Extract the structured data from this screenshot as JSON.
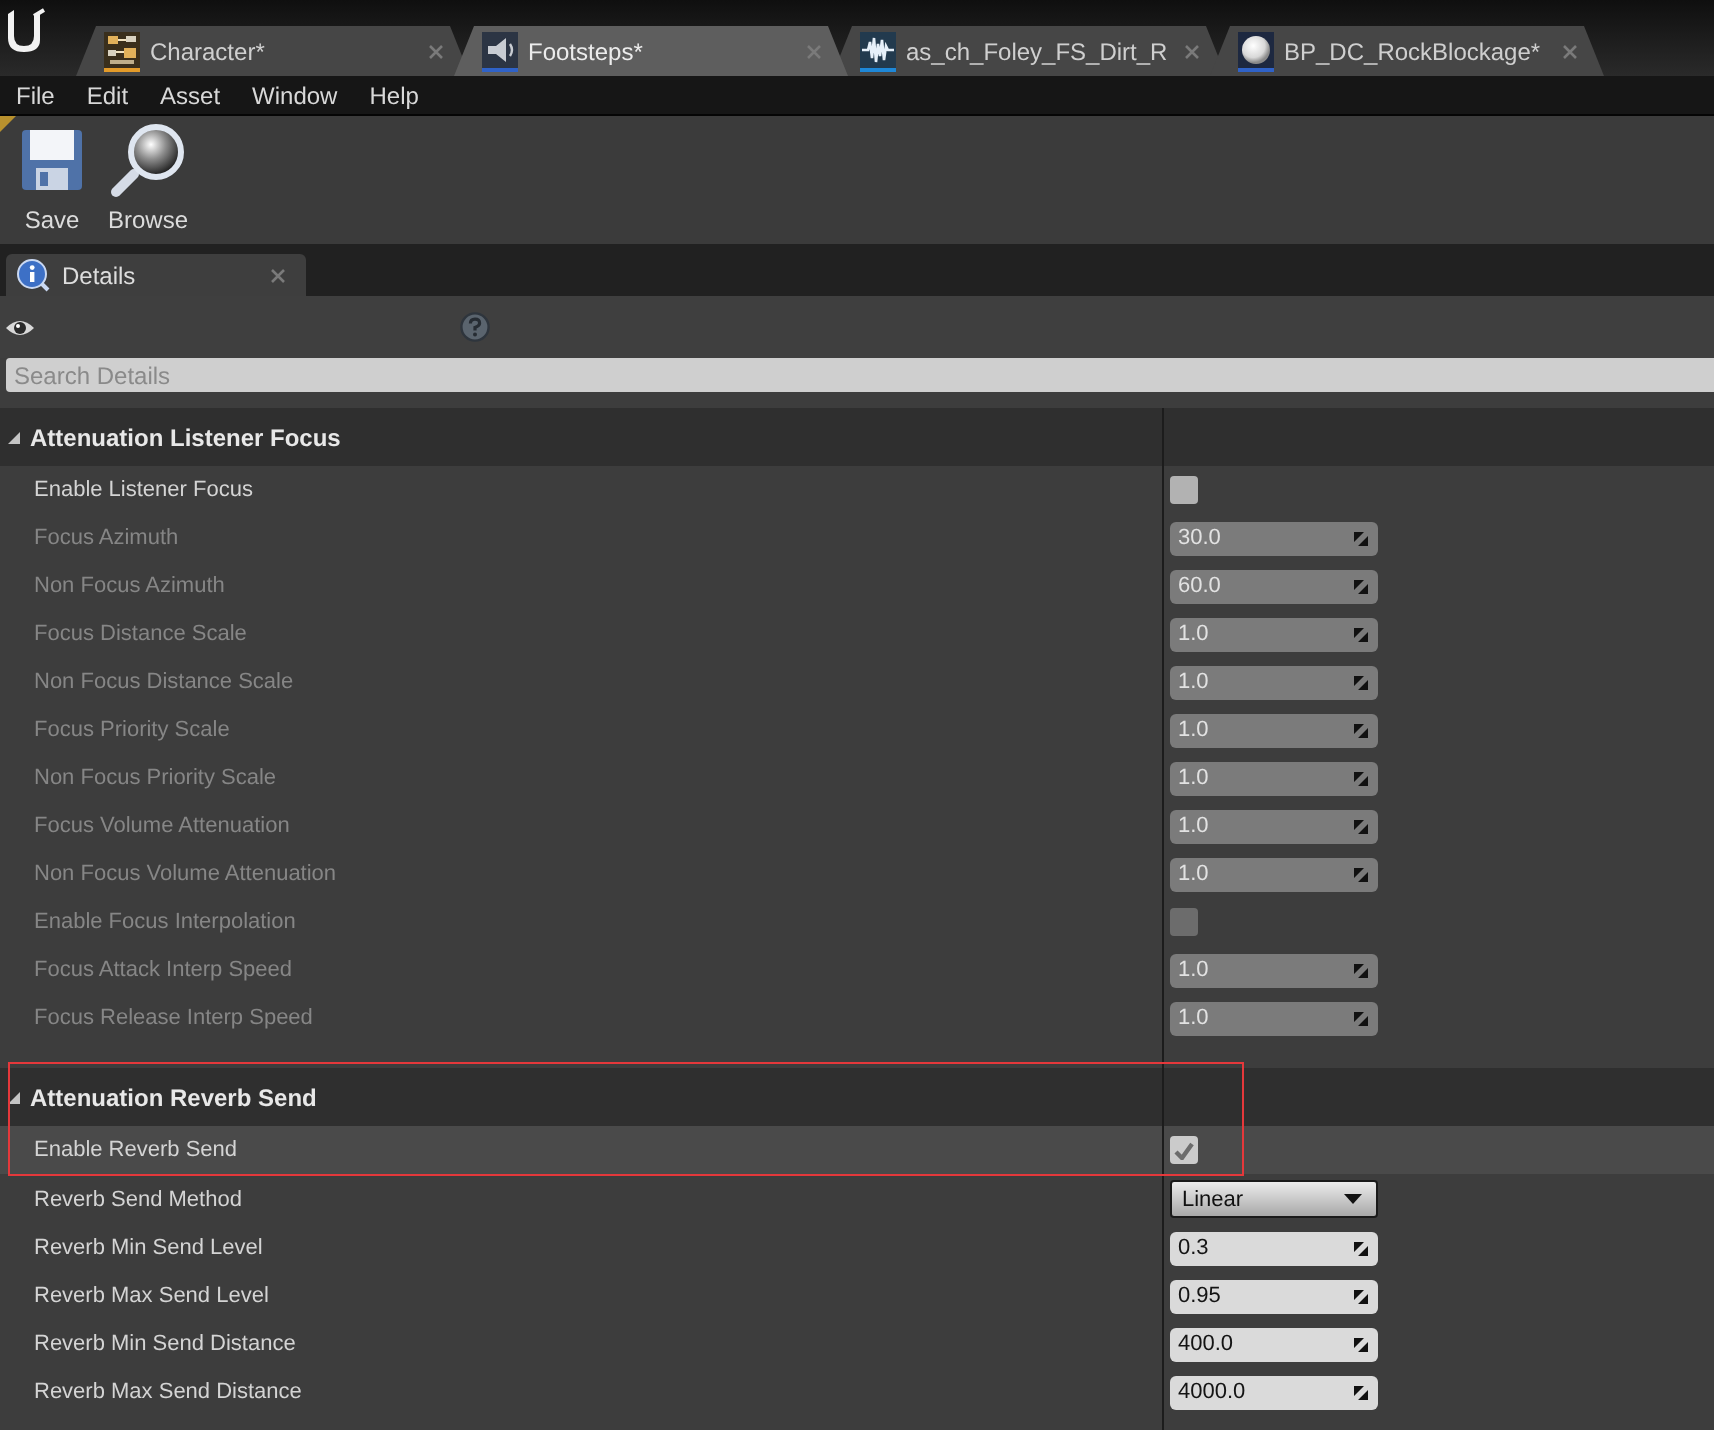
{
  "document_tabs": [
    {
      "label": "Character*",
      "kind": "blueprint",
      "color": "#e39b2a",
      "selected": false
    },
    {
      "label": "Footsteps*",
      "kind": "sound_cue",
      "color": "#2f62c8",
      "selected": true
    },
    {
      "label": "as_ch_Foley_FS_Dirt_R",
      "kind": "sound_wave",
      "color": "#1e88d8",
      "selected": false
    },
    {
      "label": "BP_DC_RockBlockage*",
      "kind": "actor",
      "color": "#2f62c8",
      "selected": false
    }
  ],
  "menu": [
    "File",
    "Edit",
    "Asset",
    "Window",
    "Help"
  ],
  "toolbar": [
    {
      "label": "Save",
      "kind": "save"
    },
    {
      "label": "Browse",
      "kind": "browse"
    }
  ],
  "details_panel": {
    "tab": {
      "label": "Details"
    },
    "search": {
      "placeholder": "Search Details"
    },
    "sections": [
      {
        "title": "Attenuation Listener Focus",
        "expanded": true,
        "outlined": false,
        "rows": [
          {
            "label": "Enable Listener Focus",
            "kind": "checkbox",
            "checked": false,
            "disabled": false,
            "hovered": false
          },
          {
            "label": "Focus Azimuth",
            "kind": "number",
            "value": "30.0",
            "disabled": true,
            "hovered": false
          },
          {
            "label": "Non Focus Azimuth",
            "kind": "number",
            "value": "60.0",
            "disabled": true,
            "hovered": false
          },
          {
            "label": "Focus Distance Scale",
            "kind": "number",
            "value": "1.0",
            "disabled": true,
            "hovered": false
          },
          {
            "label": "Non Focus Distance Scale",
            "kind": "number",
            "value": "1.0",
            "disabled": true,
            "hovered": false
          },
          {
            "label": "Focus Priority Scale",
            "kind": "number",
            "value": "1.0",
            "disabled": true,
            "hovered": false
          },
          {
            "label": "Non Focus Priority Scale",
            "kind": "number",
            "value": "1.0",
            "disabled": true,
            "hovered": false
          },
          {
            "label": "Focus Volume Attenuation",
            "kind": "number",
            "value": "1.0",
            "disabled": true,
            "hovered": false
          },
          {
            "label": "Non Focus Volume Attenuation",
            "kind": "number",
            "value": "1.0",
            "disabled": true,
            "hovered": false
          },
          {
            "label": "Enable Focus Interpolation",
            "kind": "checkbox",
            "checked": false,
            "disabled": true,
            "hovered": false
          },
          {
            "label": "Focus Attack Interp Speed",
            "kind": "number",
            "value": "1.0",
            "disabled": true,
            "hovered": false
          },
          {
            "label": "Focus Release Interp Speed",
            "kind": "number",
            "value": "1.0",
            "disabled": true,
            "hovered": false
          }
        ]
      },
      {
        "title": "Attenuation Reverb Send",
        "expanded": true,
        "outlined": true,
        "rows": [
          {
            "label": "Enable Reverb Send",
            "kind": "checkbox",
            "checked": true,
            "disabled": false,
            "hovered": true
          },
          {
            "label": "Reverb Send Method",
            "kind": "dropdown",
            "value": "Linear",
            "disabled": false,
            "hovered": false
          },
          {
            "label": "Reverb Min Send Level",
            "kind": "number",
            "value": "0.3",
            "disabled": false,
            "hovered": false
          },
          {
            "label": "Reverb Max Send Level",
            "kind": "number",
            "value": "0.95",
            "disabled": false,
            "hovered": false
          },
          {
            "label": "Reverb Min Send Distance",
            "kind": "number",
            "value": "400.0",
            "disabled": false,
            "hovered": false
          },
          {
            "label": "Reverb Max Send Distance",
            "kind": "number",
            "value": "4000.0",
            "disabled": false,
            "hovered": false
          }
        ]
      }
    ]
  }
}
